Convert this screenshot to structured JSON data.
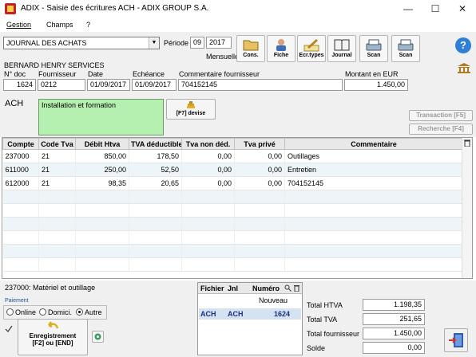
{
  "window": {
    "title": "ADIX - Saisie des écritures  ACH - ADIX GROUP S.A."
  },
  "menu": {
    "items": [
      "Gestion",
      "Champs",
      "?"
    ]
  },
  "journal": {
    "value": "JOURNAL DES ACHATS"
  },
  "periode": {
    "label": "Période",
    "month": "09",
    "year": "2017",
    "sub": "Mensuelle"
  },
  "toolbar": {
    "buttons": [
      {
        "label": "Cons.",
        "icon": "folder-icon"
      },
      {
        "label": "Fiche",
        "icon": "person-icon"
      },
      {
        "label": "Ecr.types",
        "icon": "pen-icon"
      },
      {
        "label": "Journal",
        "icon": "book-icon"
      },
      {
        "label": "Scan",
        "icon": "scanner-icon"
      },
      {
        "label": "Scan",
        "icon": "scanner-icon"
      }
    ]
  },
  "supplier": {
    "name": "BERNARD HENRY SERVICES"
  },
  "header": {
    "doc_label": "N° doc",
    "doc": "1624",
    "fourn_label": "Fournisseur",
    "fourn": "0212",
    "date_label": "Date",
    "date": "01/09/2017",
    "ech_label": "Echéance",
    "ech": "01/09/2017",
    "comm_label": "Commentaire fournisseur",
    "comm": "704152145",
    "mont_label": "Montant en EUR",
    "mont": "1.450,00"
  },
  "journal_code": "ACH",
  "description": "Installation et formation",
  "devise_button": "[F7] devise",
  "side_buttons": {
    "transaction": "Transaction [F5]",
    "recherche": "Recherche [F4]"
  },
  "grid": {
    "columns": [
      "Compte",
      "Code Tva",
      "Débit Htva",
      "TVA déductible",
      "Tva non déd.",
      "Tva privé",
      "Commentaire"
    ],
    "rows": [
      [
        "237000",
        "21",
        "850,00",
        "178,50",
        "0,00",
        "0,00",
        "Outillages"
      ],
      [
        "611000",
        "21",
        "250,00",
        "52,50",
        "0,00",
        "0,00",
        "Entretien"
      ],
      [
        "612000",
        "21",
        "98,35",
        "20,65",
        "0,00",
        "0,00",
        "704152145"
      ]
    ]
  },
  "status": {
    "account": "237000: Matériel et outillage"
  },
  "paiement": {
    "label": "Paiement",
    "options": [
      "Online",
      "Domici.",
      "Autre"
    ],
    "selected": "Autre"
  },
  "enregistrement": {
    "line1": "Enregistrement",
    "line2": "[F2] ou [END]"
  },
  "jnl": {
    "headers": [
      "Fichier",
      "Jnl",
      "Numéro"
    ],
    "nouveau": "Nouveau",
    "row": [
      "ACH",
      "ACH",
      "1624"
    ]
  },
  "totals": [
    {
      "label": "Total HTVA",
      "value": "1.198,35"
    },
    {
      "label": "Total TVA",
      "value": "251,65"
    },
    {
      "label": "Total fournisseur",
      "value": "1.450,00"
    },
    {
      "label": "Solde",
      "value": "0,00"
    }
  ]
}
